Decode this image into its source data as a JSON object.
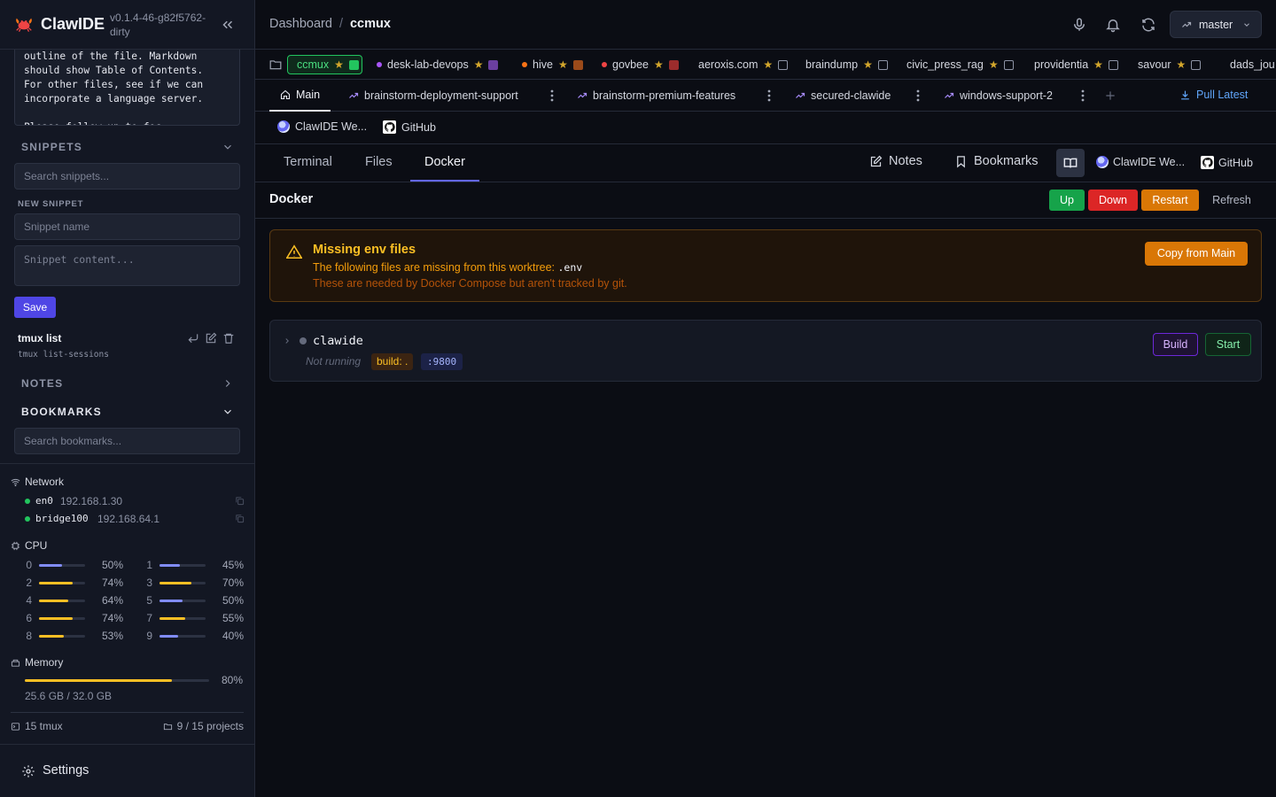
{
  "app": {
    "name": "ClawIDE",
    "version": "v0.1.4-46-g82f5762-dirty"
  },
  "sidebar": {
    "notes_text": "outline of the file. Markdown\nshould show Table of Contents.\nFor other files, see if we can\nincorporate a language server.\n\nPlease follow up to foc",
    "snippets": {
      "heading": "SNIPPETS",
      "search_placeholder": "Search snippets...",
      "new_label": "NEW SNIPPET",
      "name_placeholder": "Snippet name",
      "content_placeholder": "Snippet content...",
      "save_label": "Save",
      "items": [
        {
          "name": "tmux list",
          "command": "tmux list-sessions"
        }
      ]
    },
    "notes_heading": "NOTES",
    "bookmarks": {
      "heading": "BOOKMARKS",
      "search_placeholder": "Search bookmarks..."
    },
    "system": {
      "network_label": "Network",
      "interfaces": [
        {
          "name": "en0",
          "ip": "192.168.1.30"
        },
        {
          "name": "bridge100",
          "ip": "192.168.64.1"
        }
      ],
      "cpu_label": "CPU",
      "cores": [
        {
          "idx": "0",
          "pct": 50,
          "label": "50%"
        },
        {
          "idx": "1",
          "pct": 45,
          "label": "45%"
        },
        {
          "idx": "2",
          "pct": 74,
          "label": "74%"
        },
        {
          "idx": "3",
          "pct": 70,
          "label": "70%"
        },
        {
          "idx": "4",
          "pct": 64,
          "label": "64%"
        },
        {
          "idx": "5",
          "pct": 50,
          "label": "50%"
        },
        {
          "idx": "6",
          "pct": 74,
          "label": "74%"
        },
        {
          "idx": "7",
          "pct": 55,
          "label": "55%"
        },
        {
          "idx": "8",
          "pct": 53,
          "label": "53%"
        },
        {
          "idx": "9",
          "pct": 40,
          "label": "40%"
        }
      ],
      "memory_label": "Memory",
      "memory_pct": 80,
      "memory_pct_label": "80%",
      "memory_detail": "25.6 GB / 32.0 GB",
      "tmux_count": "15 tmux",
      "projects_count": "9 / 15 projects"
    },
    "settings_label": "Settings"
  },
  "topbar": {
    "breadcrumb_root": "Dashboard",
    "breadcrumb_sep": "/",
    "breadcrumb_current": "ccmux",
    "branch": "master"
  },
  "projects": [
    {
      "name": "ccmux",
      "dot": "",
      "sq": "#22c55e",
      "active": true
    },
    {
      "name": "desk-lab-devops",
      "dot": "#a855f7",
      "sq": "#6b3fa0"
    },
    {
      "name": "hive",
      "dot": "#f97316",
      "sq": "#9a4a1a"
    },
    {
      "name": "govbee",
      "dot": "#ef4444",
      "sq": "#9b2c2c"
    },
    {
      "name": "aeroxis.com",
      "dot": "",
      "sq": ""
    },
    {
      "name": "braindump",
      "dot": "",
      "sq": ""
    },
    {
      "name": "civic_press_rag",
      "dot": "",
      "sq": ""
    },
    {
      "name": "providentia",
      "dot": "",
      "sq": ""
    },
    {
      "name": "savour",
      "dot": "",
      "sq": ""
    },
    {
      "name": "dads_jou",
      "dot": "",
      "sq": "",
      "nostar": true
    }
  ],
  "worktrees": {
    "items": [
      {
        "label": "Main",
        "active": true
      },
      {
        "label": "brainstorm-deployment-support"
      },
      {
        "label": "brainstorm-premium-features"
      },
      {
        "label": "secured-clawide"
      },
      {
        "label": "windows-support-2"
      }
    ],
    "pull_label": "Pull Latest"
  },
  "links": [
    {
      "label": "ClawIDE We..."
    },
    {
      "label": "GitHub"
    }
  ],
  "tabs": {
    "items": [
      "Terminal",
      "Files",
      "Docker"
    ],
    "active": "Docker",
    "notes_label": "Notes",
    "bookmarks_label": "Bookmarks",
    "link1": "ClawIDE We...",
    "link2": "GitHub"
  },
  "docker": {
    "title": "Docker",
    "up_label": "Up",
    "down_label": "Down",
    "restart_label": "Restart",
    "refresh_label": "Refresh",
    "warning": {
      "title": "Missing env files",
      "line1_prefix": "The following files are missing from this worktree: ",
      "file": ".env",
      "line2": "These are needed by Docker Compose but aren't tracked by git.",
      "button": "Copy from Main"
    },
    "service": {
      "name": "clawide",
      "status": "Not running",
      "build_tag": "build: .",
      "port_tag": ":9800",
      "build_label": "Build",
      "start_label": "Start"
    }
  }
}
